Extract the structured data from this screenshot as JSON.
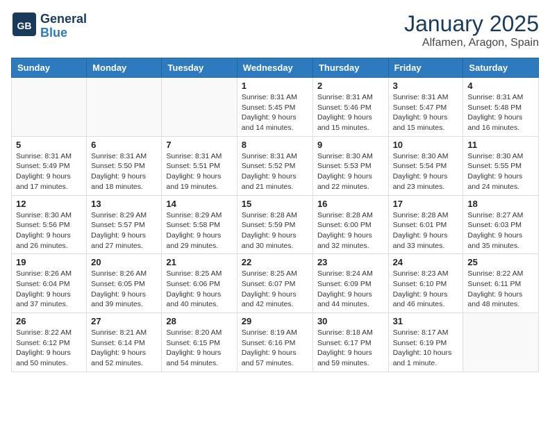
{
  "header": {
    "logo_general": "General",
    "logo_blue": "Blue",
    "month": "January 2025",
    "location": "Alfamen, Aragon, Spain"
  },
  "days_of_week": [
    "Sunday",
    "Monday",
    "Tuesday",
    "Wednesday",
    "Thursday",
    "Friday",
    "Saturday"
  ],
  "weeks": [
    [
      {
        "day": "",
        "info": ""
      },
      {
        "day": "",
        "info": ""
      },
      {
        "day": "",
        "info": ""
      },
      {
        "day": "1",
        "info": "Sunrise: 8:31 AM\nSunset: 5:45 PM\nDaylight: 9 hours\nand 14 minutes."
      },
      {
        "day": "2",
        "info": "Sunrise: 8:31 AM\nSunset: 5:46 PM\nDaylight: 9 hours\nand 15 minutes."
      },
      {
        "day": "3",
        "info": "Sunrise: 8:31 AM\nSunset: 5:47 PM\nDaylight: 9 hours\nand 15 minutes."
      },
      {
        "day": "4",
        "info": "Sunrise: 8:31 AM\nSunset: 5:48 PM\nDaylight: 9 hours\nand 16 minutes."
      }
    ],
    [
      {
        "day": "5",
        "info": "Sunrise: 8:31 AM\nSunset: 5:49 PM\nDaylight: 9 hours\nand 17 minutes."
      },
      {
        "day": "6",
        "info": "Sunrise: 8:31 AM\nSunset: 5:50 PM\nDaylight: 9 hours\nand 18 minutes."
      },
      {
        "day": "7",
        "info": "Sunrise: 8:31 AM\nSunset: 5:51 PM\nDaylight: 9 hours\nand 19 minutes."
      },
      {
        "day": "8",
        "info": "Sunrise: 8:31 AM\nSunset: 5:52 PM\nDaylight: 9 hours\nand 21 minutes."
      },
      {
        "day": "9",
        "info": "Sunrise: 8:30 AM\nSunset: 5:53 PM\nDaylight: 9 hours\nand 22 minutes."
      },
      {
        "day": "10",
        "info": "Sunrise: 8:30 AM\nSunset: 5:54 PM\nDaylight: 9 hours\nand 23 minutes."
      },
      {
        "day": "11",
        "info": "Sunrise: 8:30 AM\nSunset: 5:55 PM\nDaylight: 9 hours\nand 24 minutes."
      }
    ],
    [
      {
        "day": "12",
        "info": "Sunrise: 8:30 AM\nSunset: 5:56 PM\nDaylight: 9 hours\nand 26 minutes."
      },
      {
        "day": "13",
        "info": "Sunrise: 8:29 AM\nSunset: 5:57 PM\nDaylight: 9 hours\nand 27 minutes."
      },
      {
        "day": "14",
        "info": "Sunrise: 8:29 AM\nSunset: 5:58 PM\nDaylight: 9 hours\nand 29 minutes."
      },
      {
        "day": "15",
        "info": "Sunrise: 8:28 AM\nSunset: 5:59 PM\nDaylight: 9 hours\nand 30 minutes."
      },
      {
        "day": "16",
        "info": "Sunrise: 8:28 AM\nSunset: 6:00 PM\nDaylight: 9 hours\nand 32 minutes."
      },
      {
        "day": "17",
        "info": "Sunrise: 8:28 AM\nSunset: 6:01 PM\nDaylight: 9 hours\nand 33 minutes."
      },
      {
        "day": "18",
        "info": "Sunrise: 8:27 AM\nSunset: 6:03 PM\nDaylight: 9 hours\nand 35 minutes."
      }
    ],
    [
      {
        "day": "19",
        "info": "Sunrise: 8:26 AM\nSunset: 6:04 PM\nDaylight: 9 hours\nand 37 minutes."
      },
      {
        "day": "20",
        "info": "Sunrise: 8:26 AM\nSunset: 6:05 PM\nDaylight: 9 hours\nand 39 minutes."
      },
      {
        "day": "21",
        "info": "Sunrise: 8:25 AM\nSunset: 6:06 PM\nDaylight: 9 hours\nand 40 minutes."
      },
      {
        "day": "22",
        "info": "Sunrise: 8:25 AM\nSunset: 6:07 PM\nDaylight: 9 hours\nand 42 minutes."
      },
      {
        "day": "23",
        "info": "Sunrise: 8:24 AM\nSunset: 6:09 PM\nDaylight: 9 hours\nand 44 minutes."
      },
      {
        "day": "24",
        "info": "Sunrise: 8:23 AM\nSunset: 6:10 PM\nDaylight: 9 hours\nand 46 minutes."
      },
      {
        "day": "25",
        "info": "Sunrise: 8:22 AM\nSunset: 6:11 PM\nDaylight: 9 hours\nand 48 minutes."
      }
    ],
    [
      {
        "day": "26",
        "info": "Sunrise: 8:22 AM\nSunset: 6:12 PM\nDaylight: 9 hours\nand 50 minutes."
      },
      {
        "day": "27",
        "info": "Sunrise: 8:21 AM\nSunset: 6:14 PM\nDaylight: 9 hours\nand 52 minutes."
      },
      {
        "day": "28",
        "info": "Sunrise: 8:20 AM\nSunset: 6:15 PM\nDaylight: 9 hours\nand 54 minutes."
      },
      {
        "day": "29",
        "info": "Sunrise: 8:19 AM\nSunset: 6:16 PM\nDaylight: 9 hours\nand 57 minutes."
      },
      {
        "day": "30",
        "info": "Sunrise: 8:18 AM\nSunset: 6:17 PM\nDaylight: 9 hours\nand 59 minutes."
      },
      {
        "day": "31",
        "info": "Sunrise: 8:17 AM\nSunset: 6:19 PM\nDaylight: 10 hours\nand 1 minute."
      },
      {
        "day": "",
        "info": ""
      }
    ]
  ]
}
